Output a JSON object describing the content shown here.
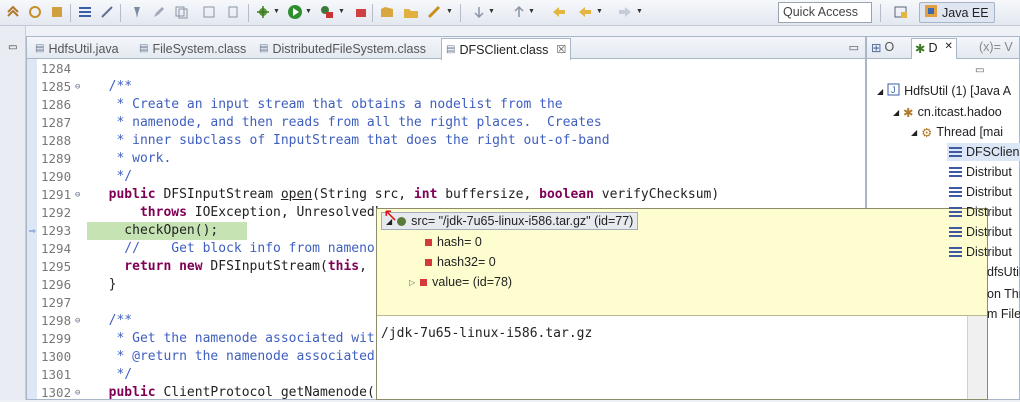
{
  "toolbar": {
    "quick_access_placeholder": "Quick Access",
    "perspective_label": "Java EE"
  },
  "editor": {
    "tabs": [
      {
        "label": "HdfsUtil.java",
        "icon": "java-file-icon",
        "active": false
      },
      {
        "label": "FileSystem.class",
        "icon": "class-file-icon",
        "active": false
      },
      {
        "label": "DistributedFileSystem.class",
        "icon": "class-file-icon",
        "active": false
      },
      {
        "label": "DFSClient.class",
        "icon": "class-file-icon",
        "active": true
      }
    ],
    "code_lines": [
      {
        "num": "1284",
        "tokens": []
      },
      {
        "num": "1285",
        "tokens": [
          {
            "t": "  /**",
            "c": "cm"
          }
        ]
      },
      {
        "num": "1286",
        "tokens": [
          {
            "t": "   * Create an input stream that obtains a nodelist from the",
            "c": "cm"
          }
        ]
      },
      {
        "num": "1287",
        "tokens": [
          {
            "t": "   * namenode, and then reads from all the right places.  Creates",
            "c": "cm"
          }
        ]
      },
      {
        "num": "1288",
        "tokens": [
          {
            "t": "   * inner subclass of InputStream that does the right out-of-band",
            "c": "cm"
          }
        ]
      },
      {
        "num": "1289",
        "tokens": [
          {
            "t": "   * work.",
            "c": "cm"
          }
        ]
      },
      {
        "num": "1290",
        "tokens": [
          {
            "t": "   */",
            "c": "cm"
          }
        ]
      },
      {
        "num": "1291",
        "tokens": [
          {
            "t": "  public",
            "c": "kw"
          },
          {
            "t": " DFSInputStream ",
            "c": "pl"
          },
          {
            "t": "open",
            "c": "pl",
            "u": true
          },
          {
            "t": "(String src, ",
            "c": "pl"
          },
          {
            "t": "int",
            "c": "kw"
          },
          {
            "t": " buffersize, ",
            "c": "pl"
          },
          {
            "t": "boolean",
            "c": "kw"
          },
          {
            "t": " verifyChecksum)",
            "c": "pl"
          }
        ]
      },
      {
        "num": "1292",
        "tokens": [
          {
            "t": "      throws",
            "c": "kw"
          },
          {
            "t": " IOException, UnresolvedL",
            "c": "pl"
          }
        ]
      },
      {
        "num": "1293",
        "tokens": [
          {
            "t": "    checkOpen();",
            "c": "pl"
          }
        ],
        "current": true
      },
      {
        "num": "1294",
        "tokens": [
          {
            "t": "    //    Get block info from nameno",
            "c": "cm"
          }
        ]
      },
      {
        "num": "1295",
        "tokens": [
          {
            "t": "    return",
            "c": "kw"
          },
          {
            "t": " ",
            "c": "pl"
          },
          {
            "t": "new",
            "c": "kw"
          },
          {
            "t": " DFSInputStream(",
            "c": "pl"
          },
          {
            "t": "this",
            "c": "kw"
          },
          {
            "t": ", ",
            "c": "pl"
          }
        ]
      },
      {
        "num": "1296",
        "tokens": [
          {
            "t": "  }",
            "c": "pl"
          }
        ]
      },
      {
        "num": "1297",
        "tokens": []
      },
      {
        "num": "1298",
        "tokens": [
          {
            "t": "  /**",
            "c": "cm"
          }
        ]
      },
      {
        "num": "1299",
        "tokens": [
          {
            "t": "   * Get the namenode associated wit",
            "c": "cm"
          }
        ]
      },
      {
        "num": "1300",
        "tokens": [
          {
            "t": "   * @return the namenode associated",
            "c": "cm"
          }
        ]
      },
      {
        "num": "1301",
        "tokens": [
          {
            "t": "   */",
            "c": "cm"
          }
        ]
      },
      {
        "num": "1302",
        "tokens": [
          {
            "t": "  public",
            "c": "kw"
          },
          {
            "t": " ClientProtocol getNamenode(",
            "c": "pl"
          }
        ]
      }
    ]
  },
  "popup": {
    "root": "src= \"/jdk-7u65-linux-i586.tar.gz\" (id=77)",
    "fields": [
      "hash= 0",
      "hash32= 0",
      "value= (id=78)"
    ],
    "detail_value": "/jdk-7u65-linux-i586.tar.gz"
  },
  "debug_view": {
    "tabs": [
      {
        "label": "O",
        "icon": "outline-icon",
        "active": false
      },
      {
        "label": "D",
        "icon": "debug-icon",
        "active": true
      },
      {
        "label": "(x)= V",
        "icon": "variables-icon",
        "active": false
      }
    ],
    "items": [
      "HdfsUtil (1) [Java A",
      "cn.itcast.hadoo",
      "Thread [mai",
      "DFSClien",
      "Distribut",
      "Distribut",
      "Distribut",
      "Distribut",
      "Distribut",
      "dfsUtil.",
      "on Thr",
      "m File"
    ]
  }
}
